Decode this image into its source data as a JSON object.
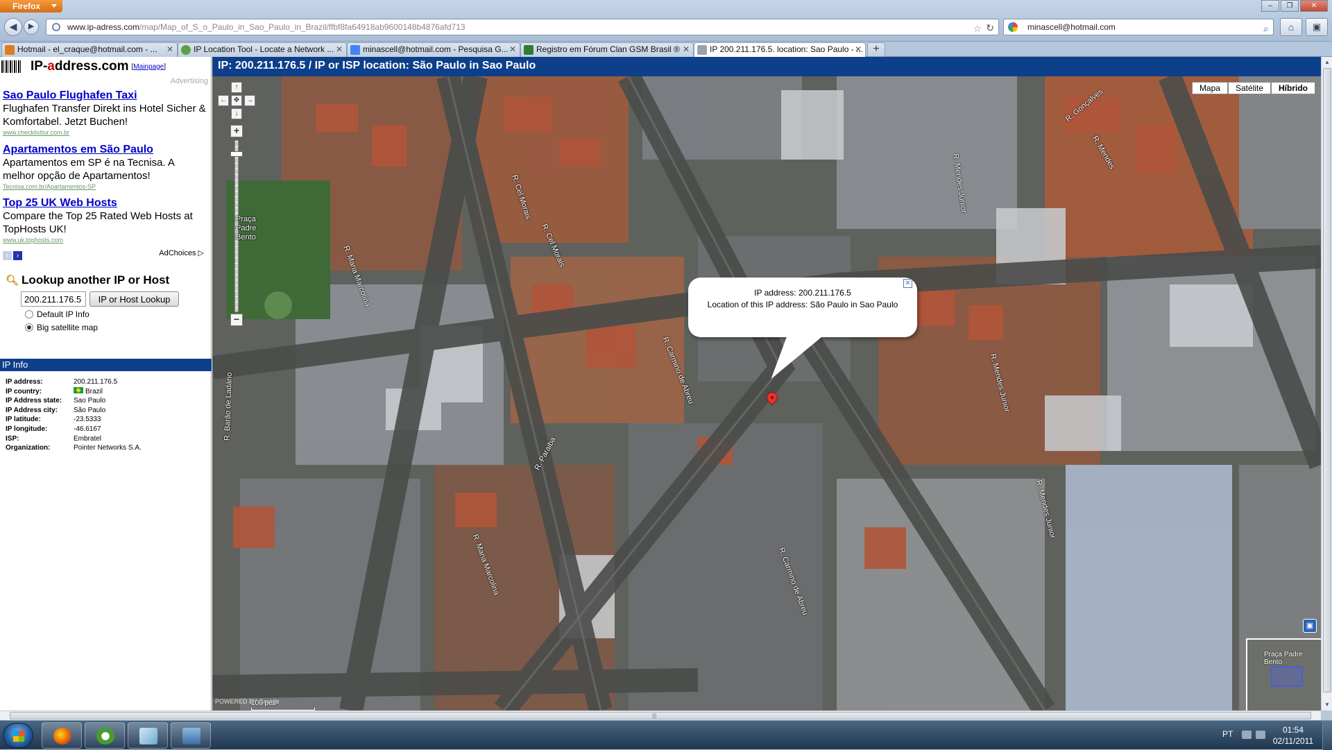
{
  "browser": {
    "app_button": "Firefox",
    "url_host": "www.ip-adress.com",
    "url_path": "/map/Map_of_S_o_Paulo_in_Sao_Paulo_in_Brazil/ffbf8fa64918ab9600148b4876afd713",
    "search_value": "minascell@hotmail.com"
  },
  "tabs": [
    {
      "label": "Hotmail - el_craque@hotmail.com - ...",
      "fav": "#e07b1f"
    },
    {
      "label": "IP Location Tool - Locate a Network ...",
      "fav": "#5aa04a"
    },
    {
      "label": "minascell@hotmail.com - Pesquisa G...",
      "fav": "#4285f4"
    },
    {
      "label": "Registro em Fórum Clan GSM Brasil ®",
      "fav": "#2e7d32"
    },
    {
      "label": "IP 200.211.176.5. location: Sao Paulo - ...",
      "fav": "#9aa3ad"
    }
  ],
  "sidebar": {
    "logo_left": "IP-",
    "logo_mid": "a",
    "logo_right": "ddress.com",
    "mainpage": "Mainpage",
    "advertising": "Advertising",
    "ads": [
      {
        "title": "Sao Paulo Flughafen Taxi",
        "desc": "Flughafen Transfer Direkt ins Hotel Sicher & Komfortabel. Jetzt Buchen!",
        "url": "www.checklisttur.com.br"
      },
      {
        "title": "Apartamentos em São Paulo",
        "desc": "Apartamentos em SP é na Tecnisa. A melhor opção de Apartamentos!",
        "url": "Tecnisa.com.br/Apartamentos-SP"
      },
      {
        "title": "Top 25 UK Web Hosts",
        "desc": "Compare the Top 25 Rated Web Hosts at TopHosts UK!",
        "url": "www.uk.tophosts.com"
      }
    ],
    "adchoices": "AdChoices ▷",
    "lookup_title": "Lookup another IP or Host",
    "ip_value": "200.211.176.5",
    "lookup_button": "IP or Host Lookup",
    "radio_default": "Default IP Info",
    "radio_map": "Big satellite map",
    "ipinfo_header": "IP Info",
    "ipinfo": [
      {
        "k": "IP address:",
        "v": "200.211.176.5"
      },
      {
        "k": "IP country:",
        "v": "Brazil"
      },
      {
        "k": "IP Address state:",
        "v": "Sao Paulo"
      },
      {
        "k": "IP Address city:",
        "v": "São Paulo"
      },
      {
        "k": "IP latitude:",
        "v": "-23.5333"
      },
      {
        "k": "IP longitude:",
        "v": "-46.6167"
      },
      {
        "k": "ISP:",
        "v": "Embratel"
      },
      {
        "k": "Organization:",
        "v": "Pointer Networks S.A."
      }
    ]
  },
  "map": {
    "header": "IP: 200.211.176.5 / IP or ISP location: São Paulo in Sao Paulo",
    "types": [
      "Mapa",
      "Satélite",
      "Híbrido"
    ],
    "info_line1": "IP address: 200.211.176.5",
    "info_line2": "Location of this IP address: São Paulo in Sao Paulo",
    "streets": [
      "R. Cel Morais",
      "R. Cel Morais",
      "R. Maria Marcolina",
      "R. Carmino de Abreu",
      "R. Paraiba",
      "R. Mendes Junior",
      "R. Mendes Junior",
      "R. Mendes Junior",
      "R. Barão de Ladário",
      "R. Maria Marcolina",
      "R. Carmino de Abreu",
      "R. Gonçalves",
      "R. Mendes",
      "Praça Padre Bento"
    ],
    "scale": "100 pés",
    "overview_label": "Praça Padre Bento",
    "powered": "POWERED BY Google"
  },
  "taskbar": {
    "lang": "PT",
    "time": "01:54",
    "date": "02/11/2011"
  }
}
